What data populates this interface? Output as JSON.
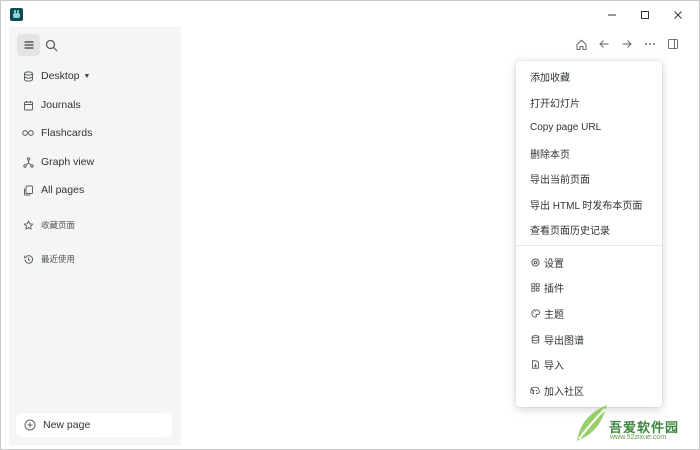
{
  "sidebar": {
    "items": [
      {
        "label": "Desktop",
        "icon": "database-icon"
      },
      {
        "label": "Journals",
        "icon": "calendar-icon"
      },
      {
        "label": "Flashcards",
        "icon": "infinity-icon"
      },
      {
        "label": "Graph view",
        "icon": "graph-icon"
      },
      {
        "label": "All pages",
        "icon": "pages-icon"
      }
    ],
    "favorites_label": "收藏页面",
    "recent_label": "最近使用",
    "new_page_label": "New page"
  },
  "menu": {
    "items": [
      "添加收藏",
      "打开幻灯片",
      "Copy page URL",
      "删除本页",
      "导出当前页面",
      "导出 HTML 时发布本页面",
      "查看页面历史记录"
    ],
    "icon_items": [
      {
        "label": "设置",
        "icon": "settings-icon"
      },
      {
        "label": "插件",
        "icon": "plugins-icon"
      },
      {
        "label": "主题",
        "icon": "palette-icon"
      },
      {
        "label": "导出图谱",
        "icon": "database-export-icon"
      },
      {
        "label": "导入",
        "icon": "file-import-icon"
      },
      {
        "label": "加入社区",
        "icon": "discord-icon"
      }
    ]
  },
  "watermark": {
    "name": "吾爱软件园",
    "url": "www.52zixue.com"
  }
}
